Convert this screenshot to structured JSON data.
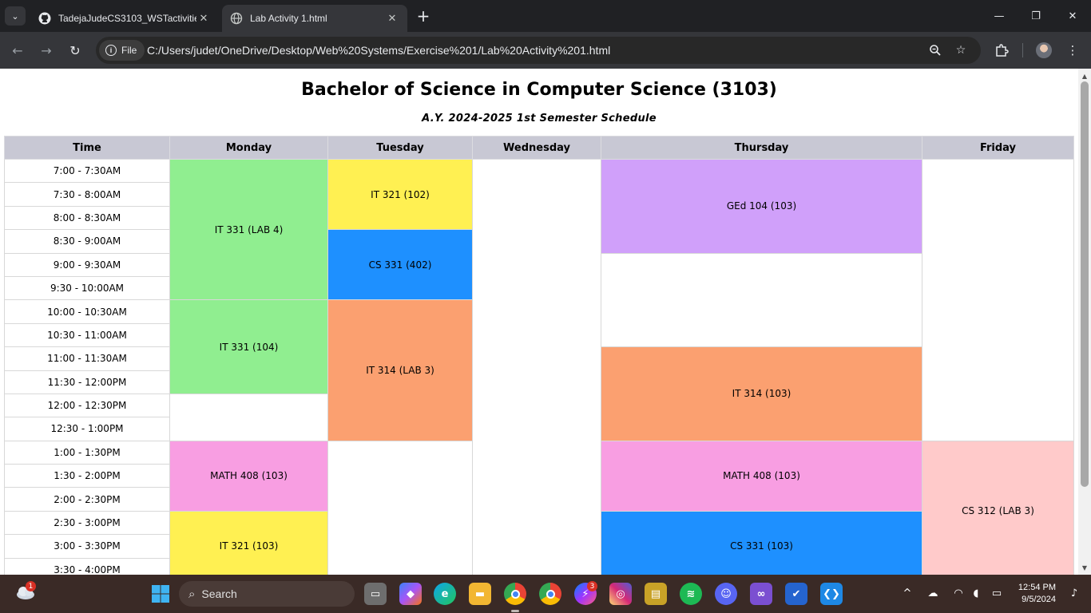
{
  "browser": {
    "tabs": [
      {
        "title": "TadejaJudeCS3103_WSTactivitie",
        "active": false,
        "icon": "github-icon"
      },
      {
        "title": "Lab Activity 1.html",
        "active": true,
        "icon": "globe-icon"
      }
    ],
    "chip_label": "File",
    "url": "C:/Users/judet/OneDrive/Desktop/Web%20Systems/Exercise%201/Lab%20Activity%201.html"
  },
  "page": {
    "title": "Bachelor of Science in Computer Science (3103)",
    "subtitle": "A.Y. 2024-2025 1st Semester Schedule",
    "headers": [
      "Time",
      "Monday",
      "Tuesday",
      "Wednesday",
      "Thursday",
      "Friday"
    ],
    "times": [
      "7:00 - 7:30AM",
      "7:30 - 8:00AM",
      "8:00 - 8:30AM",
      "8:30 - 9:00AM",
      "9:00 - 9:30AM",
      "9:30 - 10:00AM",
      "10:00 - 10:30AM",
      "10:30 - 11:00AM",
      "11:00 - 11:30AM",
      "11:30 - 12:00PM",
      "12:00 - 12:30PM",
      "12:30 - 1:00PM",
      "1:00 - 1:30PM",
      "1:30 - 2:00PM",
      "2:00 - 2:30PM",
      "2:30 - 3:00PM",
      "3:00 - 3:30PM",
      "3:30 - 4:00PM"
    ],
    "classes": {
      "mon_it331_lab4": "IT 331 (LAB 4)",
      "mon_it331_104": "IT 331 (104)",
      "mon_math408": "MATH 408 (103)",
      "mon_it321": "IT 321 (103)",
      "tue_it321": "IT 321 (102)",
      "tue_cs331": "CS 331 (402)",
      "tue_it314": "IT 314 (LAB 3)",
      "thu_ged104": "GEd 104 (103)",
      "thu_it314": "IT 314 (103)",
      "thu_math408": "MATH 408 (103)",
      "thu_cs331": "CS 331 (103)",
      "fri_cs312": "CS 312 (LAB 3)"
    },
    "colors": {
      "green": "#90ee90",
      "yellow": "#fff052",
      "blue": "#1e90ff",
      "purple": "#d0a0fa",
      "orange": "#fba070",
      "pink": "#f89ee2",
      "rose": "#ffcaca",
      "header": "#c8c8d4"
    }
  },
  "taskbar": {
    "search_label": "Search",
    "time": "12:54 PM",
    "date": "9/5/2024",
    "weather_badge": "1",
    "messenger_badge": "3"
  }
}
